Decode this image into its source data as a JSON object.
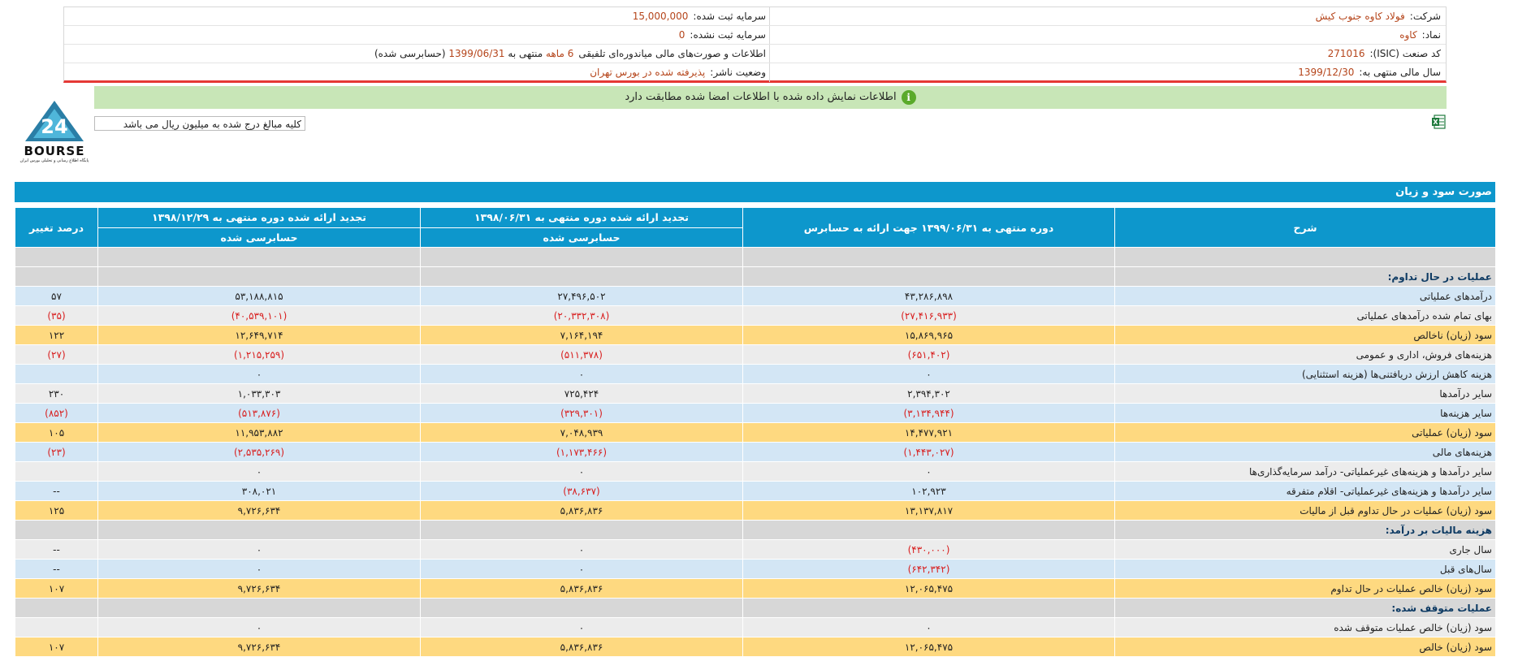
{
  "info": {
    "right": [
      {
        "label": "شرکت:",
        "value": "فولاد کاوه جنوب کیش"
      },
      {
        "label": "نماد:",
        "value": "کاوه"
      },
      {
        "label": "کد صنعت (ISIC):",
        "value": "271016"
      },
      {
        "label": "سال مالی منتهی به:",
        "value": "1399/12/30"
      }
    ],
    "left": [
      {
        "label": "سرمایه ثبت شده:",
        "value": "15,000,000"
      },
      {
        "label": "سرمایه ثبت نشده:",
        "value": "0"
      },
      {
        "label": "اطلاعات و صورت‌های مالی میاندوره‌ای تلفیقی",
        "value_a": "6 ماهه",
        "mid": "منتهی به",
        "value_b": "1399/06/31",
        "tail": "(حسابرسی شده)"
      },
      {
        "label": "وضعیت ناشر:",
        "value": "پذیرفته شده در بورس تهران"
      }
    ]
  },
  "notice": "اطلاعات نمایش داده شده با اطلاعات امضا شده مطابقت دارد",
  "logo": {
    "brand": "BOURSE",
    "number": "24",
    "tagline": "پایگاه اطلاع رسانی و تحلیلی بورس ایران"
  },
  "unit_note": "کلیه مبالغ درج شده به میلیون ریال می باشد",
  "report_title": "صورت سود و زیان",
  "colors": {
    "header_blue": "#0d97cc",
    "row_blue": "#d3e6f5",
    "row_grey": "#ececec",
    "row_yellow": "#fed980",
    "negative": "#d81e1e",
    "notice_green": "#c8e6b7"
  },
  "table": {
    "headers": {
      "desc": "شرح",
      "col1": "دوره منتهی به ۱۳۹۹/۰۶/۳۱ جهت ارائه به حسابرس",
      "col2": "تجدید ارائه شده دوره منتهی به ۱۳۹۸/۰۶/۳۱",
      "col3": "تجدید ارائه شده دوره منتهی به ۱۳۹۸/۱۲/۲۹",
      "pct": "درصد تغییر",
      "col2_sub": "حسابرسی شده",
      "col3_sub": "حسابرسی شده"
    },
    "rows": [
      {
        "type": "blank"
      },
      {
        "type": "section",
        "desc": "عملیات در حال تداوم:"
      },
      {
        "type": "blue",
        "desc": "درآمدهای عملیاتی",
        "c1": "۴۳,۲۸۶,۸۹۸",
        "c2": "۲۷,۴۹۶,۵۰۲",
        "c3": "۵۳,۱۸۸,۸۱۵",
        "pct": "۵۷"
      },
      {
        "type": "grey",
        "desc": "بهای تمام شده درآمدهای عملیاتی",
        "c1": "(۲۷,۴۱۶,۹۳۳)",
        "c2": "(۲۰,۳۳۲,۳۰۸)",
        "c3": "(۴۰,۵۳۹,۱۰۱)",
        "pct": "(۳۵)"
      },
      {
        "type": "yellow",
        "desc": "سود (زیان) ناخالص",
        "c1": "۱۵,۸۶۹,۹۶۵",
        "c2": "۷,۱۶۴,۱۹۴",
        "c3": "۱۲,۶۴۹,۷۱۴",
        "pct": "۱۲۲"
      },
      {
        "type": "grey",
        "desc": "هزینه‌های فروش، اداری و عمومی",
        "c1": "(۶۵۱,۴۰۲)",
        "c2": "(۵۱۱,۳۷۸)",
        "c3": "(۱,۲۱۵,۲۵۹)",
        "pct": "(۲۷)"
      },
      {
        "type": "blue",
        "desc": "هزینه کاهش ارزش دریافتنی‌ها (هزینه استثنایی)",
        "c1": "۰",
        "c2": "۰",
        "c3": "۰",
        "pct": ""
      },
      {
        "type": "grey",
        "desc": "سایر درآمدها",
        "c1": "۲,۳۹۴,۳۰۲",
        "c2": "۷۲۵,۴۲۴",
        "c3": "۱,۰۳۳,۳۰۳",
        "pct": "۲۳۰"
      },
      {
        "type": "blue",
        "desc": "سایر هزینه‌ها",
        "c1": "(۳,۱۳۴,۹۴۴)",
        "c2": "(۳۲۹,۳۰۱)",
        "c3": "(۵۱۳,۸۷۶)",
        "pct": "(۸۵۲)"
      },
      {
        "type": "yellow",
        "desc": "سود (زیان) عملیاتی",
        "c1": "۱۴,۴۷۷,۹۲۱",
        "c2": "۷,۰۴۸,۹۳۹",
        "c3": "۱۱,۹۵۳,۸۸۲",
        "pct": "۱۰۵"
      },
      {
        "type": "blue",
        "desc": "هزینه‌های مالی",
        "c1": "(۱,۴۴۳,۰۲۷)",
        "c2": "(۱,۱۷۳,۴۶۶)",
        "c3": "(۲,۵۳۵,۲۶۹)",
        "pct": "(۲۳)"
      },
      {
        "type": "grey",
        "desc": "سایر درآمدها و هزینه‌های غیرعملیاتی- درآمد سرمایه‌گذاری‌ها",
        "c1": "۰",
        "c2": "۰",
        "c3": "۰",
        "pct": ""
      },
      {
        "type": "blue",
        "desc": "سایر درآمدها و هزینه‌های غیرعملیاتی- اقلام متفرقه",
        "c1": "۱۰۲,۹۲۳",
        "c2": "(۳۸,۶۳۷)",
        "c3": "۳۰۸,۰۲۱",
        "pct": "--"
      },
      {
        "type": "yellow",
        "desc": "سود (زیان) عملیات در حال تداوم قبل از مالیات",
        "c1": "۱۳,۱۳۷,۸۱۷",
        "c2": "۵,۸۳۶,۸۳۶",
        "c3": "۹,۷۲۶,۶۳۴",
        "pct": "۱۲۵"
      },
      {
        "type": "section",
        "desc": "هزینه مالیات بر درآمد:"
      },
      {
        "type": "grey",
        "desc": "سال جاری",
        "c1": "(۴۳۰,۰۰۰)",
        "c2": "۰",
        "c3": "۰",
        "pct": "--"
      },
      {
        "type": "blue",
        "desc": "سال‌های قبل",
        "c1": "(۶۴۲,۳۴۲)",
        "c2": "۰",
        "c3": "۰",
        "pct": "--"
      },
      {
        "type": "yellow",
        "desc": "سود (زیان) خالص عملیات در حال تداوم",
        "c1": "۱۲,۰۶۵,۴۷۵",
        "c2": "۵,۸۳۶,۸۳۶",
        "c3": "۹,۷۲۶,۶۳۴",
        "pct": "۱۰۷"
      },
      {
        "type": "section",
        "desc": "عملیات متوقف شده:"
      },
      {
        "type": "grey",
        "desc": "سود (زیان) خالص عملیات متوقف شده",
        "c1": "۰",
        "c2": "۰",
        "c3": "۰",
        "pct": ""
      },
      {
        "type": "yellow",
        "desc": "سود (زیان) خالص",
        "c1": "۱۲,۰۶۵,۴۷۵",
        "c2": "۵,۸۳۶,۸۳۶",
        "c3": "۹,۷۲۶,۶۳۴",
        "pct": "۱۰۷"
      }
    ]
  }
}
